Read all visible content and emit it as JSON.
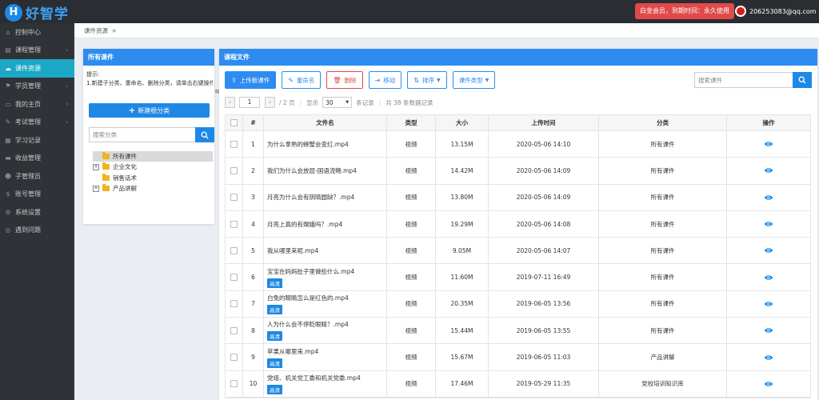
{
  "app": {
    "logo_letter": "H",
    "logo_text": "好智学"
  },
  "topbar": {
    "vip_text": "白金会员，到期时间：永久使用",
    "user_email": "206253083@qq.com",
    "user_caret": "▼"
  },
  "sidebar": {
    "items": [
      {
        "label": "控制中心",
        "icon": "home-icon",
        "glyph": "⌂",
        "caret": ""
      },
      {
        "label": "课程管理",
        "icon": "book-icon",
        "glyph": "▤",
        "caret": "‹"
      },
      {
        "label": "课件资源",
        "icon": "cloud-icon",
        "glyph": "☁",
        "caret": "",
        "active": true
      },
      {
        "label": "学员管理",
        "icon": "graduation-icon",
        "glyph": "⚑",
        "caret": "‹"
      },
      {
        "label": "我的主页",
        "icon": "tv-icon",
        "glyph": "▭",
        "caret": "‹"
      },
      {
        "label": "考试管理",
        "icon": "pen-icon",
        "glyph": "✎",
        "caret": "‹"
      },
      {
        "label": "学习记录",
        "icon": "record-icon",
        "glyph": "▦",
        "caret": ""
      },
      {
        "label": "收益管理",
        "icon": "card-icon",
        "glyph": "▬",
        "caret": ""
      },
      {
        "label": "子管理员",
        "icon": "user-icon",
        "glyph": "☻",
        "caret": ""
      },
      {
        "label": "账号管理",
        "icon": "yen-icon",
        "glyph": "$",
        "caret": ""
      },
      {
        "label": "系统设置",
        "icon": "gear-icon",
        "glyph": "⚙",
        "caret": ""
      },
      {
        "label": "遇到问题",
        "icon": "help-icon",
        "glyph": "◎",
        "caret": ""
      }
    ]
  },
  "breadcrumb": {
    "label": "课件资源",
    "dot": "◉"
  },
  "left_panel": {
    "title": "所有课件",
    "tip_title": "提示:",
    "tip_text": "1.新建子分类、重命名、删除分类，请单击右键操作...",
    "new_category_button": "新建根分类",
    "search_placeholder": "搜索分类",
    "tree": [
      {
        "label": "所有课件",
        "toggle": "",
        "selected": true
      },
      {
        "label": "企业文化",
        "toggle": "+"
      },
      {
        "label": "销售话术",
        "toggle": ""
      },
      {
        "label": "产品讲解",
        "toggle": "+"
      }
    ]
  },
  "main_panel": {
    "title": "课程文件",
    "toolbar": {
      "upload": "上传新课件",
      "rename": "重命名",
      "delete": "删除",
      "move": "移动",
      "sort": "排序",
      "type": "课件类型"
    },
    "search_placeholder": "搜索课件",
    "pager": {
      "prev": "‹",
      "next": "›",
      "current_page": "1",
      "total_pages": "/ 2 页",
      "show_label": "显示",
      "page_size": "30",
      "per_page_suffix": "条记录",
      "total_text": "共 38 条数据记录"
    },
    "columns": [
      "#",
      "文件名",
      "类型",
      "大小",
      "上传时间",
      "分类",
      "操作"
    ],
    "rows": [
      {
        "num": "1",
        "name": "为什么拿熟的螃蟹会变红.mp4",
        "badge": "",
        "type": "视频",
        "size": "13.15M",
        "time": "2020-05-06 14:10",
        "category": "所有课件"
      },
      {
        "num": "2",
        "name": "我们为什么会放屁-国语流畅.mp4",
        "badge": "",
        "type": "视频",
        "size": "14.42M",
        "time": "2020-05-06 14:09",
        "category": "所有课件"
      },
      {
        "num": "3",
        "name": "月亮为什么会有阴晴圆缺？.mp4",
        "badge": "",
        "type": "视频",
        "size": "13.80M",
        "time": "2020-05-06 14:09",
        "category": "所有课件"
      },
      {
        "num": "4",
        "name": "月亮上真的有嫦娥吗？.mp4",
        "badge": "",
        "type": "视频",
        "size": "19.29M",
        "time": "2020-05-06 14:08",
        "category": "所有课件"
      },
      {
        "num": "5",
        "name": "我从哪里来呢.mp4",
        "badge": "",
        "type": "视频",
        "size": "9.05M",
        "time": "2020-05-06 14:07",
        "category": "所有课件"
      },
      {
        "num": "6",
        "name": "宝宝在妈妈肚子里做些什么.mp4",
        "badge": "高清",
        "type": "视频",
        "size": "11.60M",
        "time": "2019-07-11 16:49",
        "category": "所有课件"
      },
      {
        "num": "7",
        "name": "白兔的眼睛怎么是红色的.mp4",
        "badge": "高清",
        "type": "视频",
        "size": "20.35M",
        "time": "2019-06-05 13:56",
        "category": "所有课件"
      },
      {
        "num": "8",
        "name": "人为什么会不停眨眼睛？.mp4",
        "badge": "高清",
        "type": "视频",
        "size": "15.44M",
        "time": "2019-06-05 13:55",
        "category": "所有课件"
      },
      {
        "num": "9",
        "name": "苹果从哪里来.mp4",
        "badge": "高清",
        "type": "视频",
        "size": "15.67M",
        "time": "2019-06-05 11:03",
        "category": "产品讲解"
      },
      {
        "num": "10",
        "name": "党组、机关党工委和机关党委.mp4",
        "badge": "高清",
        "type": "视频",
        "size": "17.46M",
        "time": "2019-05-29 11:35",
        "category": "党校培训知识库"
      }
    ]
  },
  "colors": {
    "accent": "#2d8cf0",
    "sidebar_active": "#1ca7c7",
    "danger": "#e04a4a"
  }
}
